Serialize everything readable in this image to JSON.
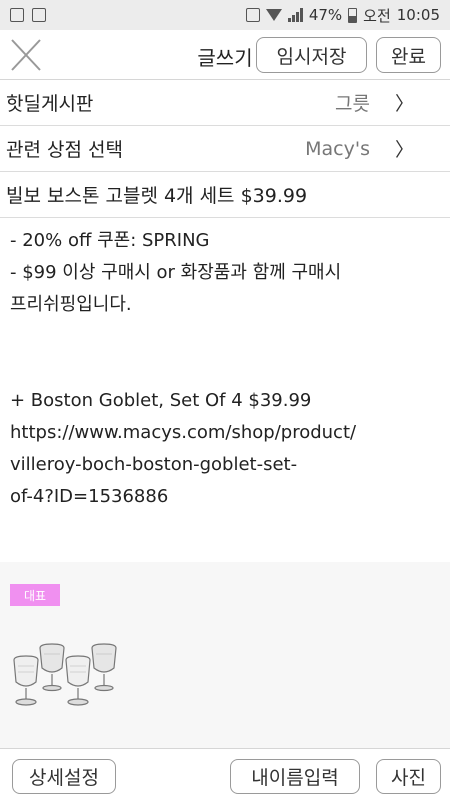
{
  "status_bar": {
    "battery": "47%",
    "ampm": "오전",
    "time": "10:05"
  },
  "header": {
    "title": "글쓰기",
    "draft_label": "임시저장",
    "done_label": "완료"
  },
  "form": {
    "board_label": "핫딜게시판",
    "board_value": "그릇",
    "store_label": "관련 상점 선택",
    "store_value": "Macy's",
    "chevron": "〉",
    "post_title": "빌보 보스톤 고블렛 4개 세트 $39.99"
  },
  "body_lines": [
    "- 20% off 쿠폰: SPRING",
    "- $99 이상 구매시 or 화장품과 함께 구매시",
    "프리쉬핑입니다.",
    "",
    "",
    "+ Boston Goblet, Set Of 4 $39.99",
    "https://www.macys.com/shop/product/",
    "villeroy-boch-boston-goblet-set-",
    "of-4?ID=1536886"
  ],
  "attachment": {
    "badge": "대표"
  },
  "bottom": {
    "settings_label": "상세설정",
    "name_label": "내이름입력",
    "photo_label": "사진"
  }
}
